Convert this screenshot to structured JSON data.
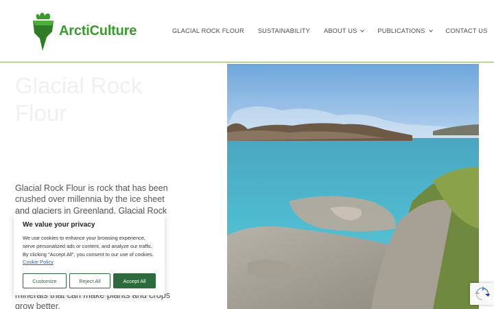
{
  "brand": {
    "name": "ArctiCulture",
    "accent_color": "#3a9a2e",
    "logo_icon": "leaf-iceberg-icon"
  },
  "nav": {
    "items": [
      {
        "label": "GLACIAL ROCK FLOUR",
        "dropdown": false
      },
      {
        "label": "SUSTAINABILITY",
        "dropdown": false
      },
      {
        "label": "ABOUT US",
        "dropdown": true
      },
      {
        "label": "PUBLICATIONS",
        "dropdown": true
      },
      {
        "label": "CONTACT US",
        "dropdown": false
      }
    ]
  },
  "hero": {
    "title": "Glacial Rock Flour",
    "body": "Glacial Rock Flour is rock that has been crushed over millennia by the ice sheet and glaciers in Greenland. Glacial Rock",
    "body_bottom": "minerals that can make plants and crops grow better."
  },
  "cookie": {
    "title": "We value your privacy",
    "text": "We use cookies to enhance your browsing experience, serve personalized ads or content, and analyze our traffic. By clicking \"Accept All\", you consent to our use of cookies.",
    "link": "Cookie Policy",
    "customize": "Customize",
    "reject": "Reject All",
    "accept": "Accept All",
    "button_color": "#2e6b3c"
  },
  "recaptcha": {
    "icon": "recaptcha-icon"
  }
}
